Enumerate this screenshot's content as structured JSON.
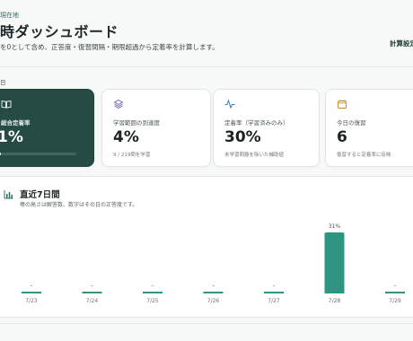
{
  "header": {
    "breadcrumb": "現在地",
    "title": "時ダッシュボード",
    "subtitle": "を0として含め、正答度・復習間隔・期限超過から定着率を計算します。",
    "settings_link": "計算設定"
  },
  "section_label": "日",
  "cards": [
    {
      "icon": "book-icon",
      "label": "総合定着率",
      "value": "1%",
      "progress_percent": 1
    },
    {
      "icon": "layers-icon",
      "label": "学習範囲の到達度",
      "value": "4%",
      "note": "9 / 219問を学習"
    },
    {
      "icon": "activity-icon",
      "label": "定着率（学習済みのみ）",
      "value": "30%",
      "note": "未学習問題を除いた補助値"
    },
    {
      "icon": "calendar-icon",
      "label": "今日の復習",
      "value": "6",
      "note": "復習すると定着率に反映"
    }
  ],
  "chart": {
    "icon": "bar-chart-icon",
    "title": "直近7日間",
    "subtitle": "棒の高さは解答数、数字はその日の正答度です。"
  },
  "chart_data": {
    "type": "bar",
    "categories": [
      "7/23",
      "7/24",
      "7/25",
      "7/26",
      "7/27",
      "7/28",
      "7/29"
    ],
    "values": [
      0,
      0,
      0,
      0,
      0,
      9,
      0
    ],
    "labels": [
      "–",
      "–",
      "–",
      "–",
      "–",
      "31%",
      "–"
    ],
    "colors": {
      "bar": "#2f9482",
      "baseline": "#2f9482"
    }
  }
}
